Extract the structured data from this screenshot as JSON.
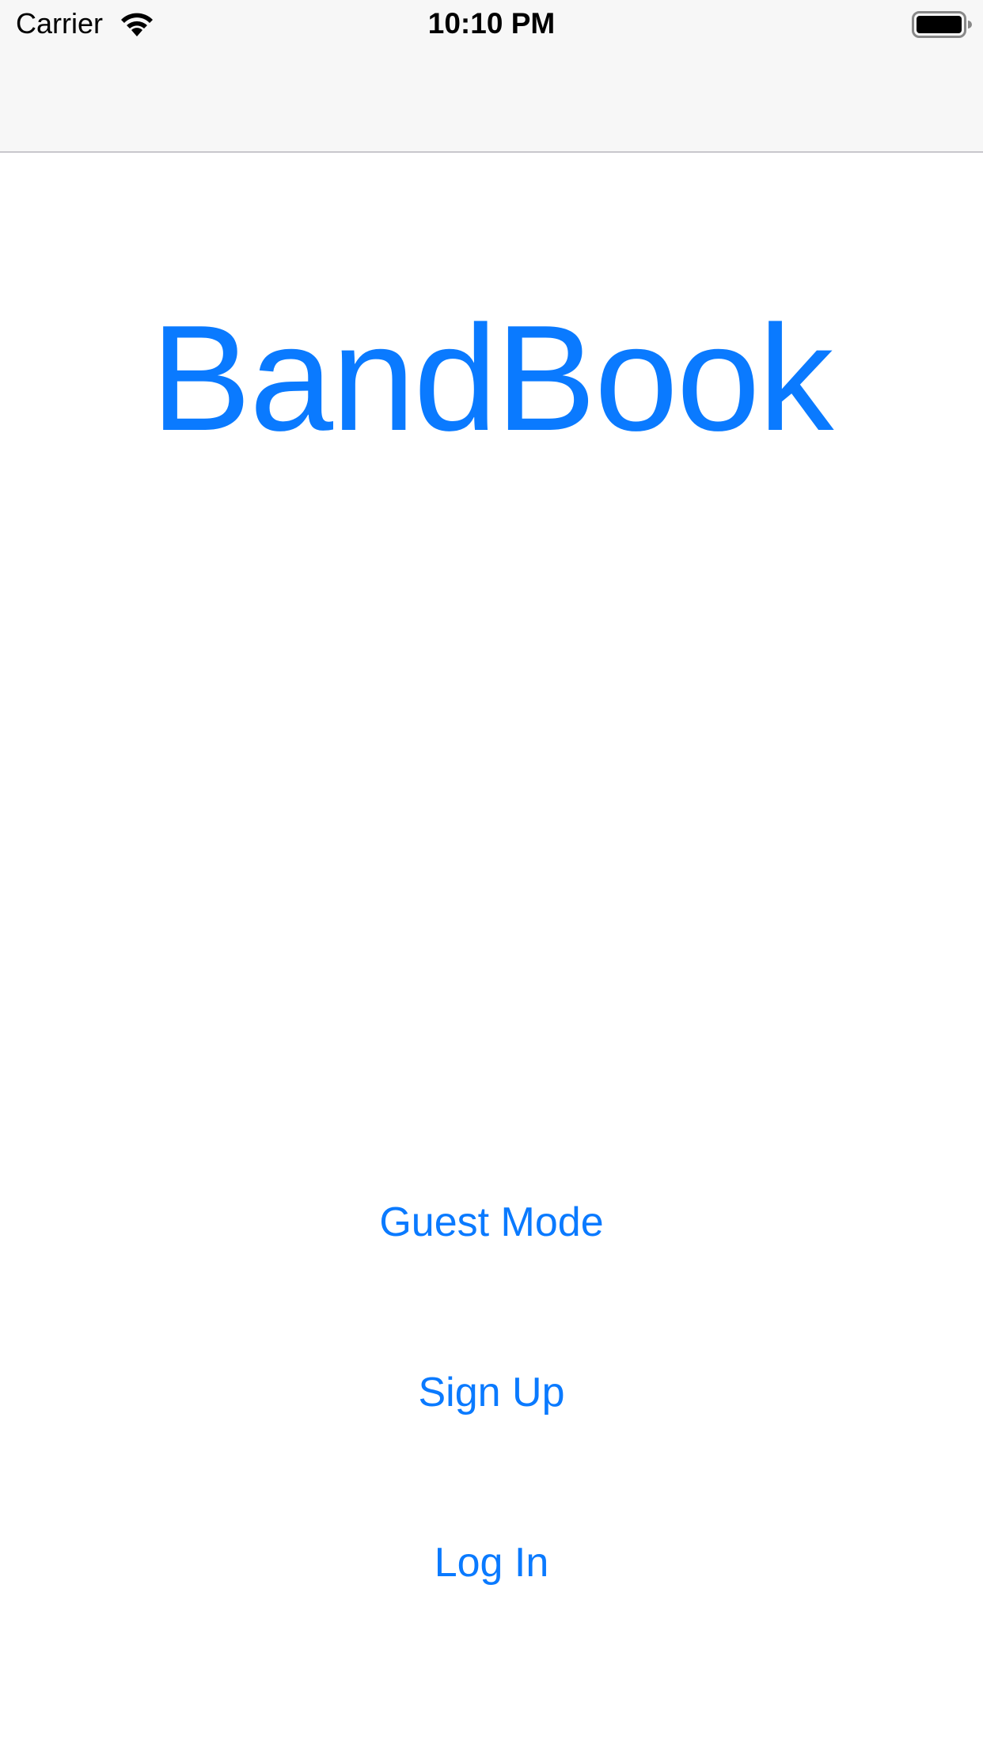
{
  "status_bar": {
    "carrier": "Carrier",
    "time": "10:10 PM",
    "icons": [
      "wifi-icon",
      "battery-icon"
    ]
  },
  "app": {
    "title": "BandBook",
    "accent_color": "#0a7aff"
  },
  "buttons": {
    "guest_mode": "Guest Mode",
    "sign_up": "Sign Up",
    "log_in": "Log In"
  }
}
